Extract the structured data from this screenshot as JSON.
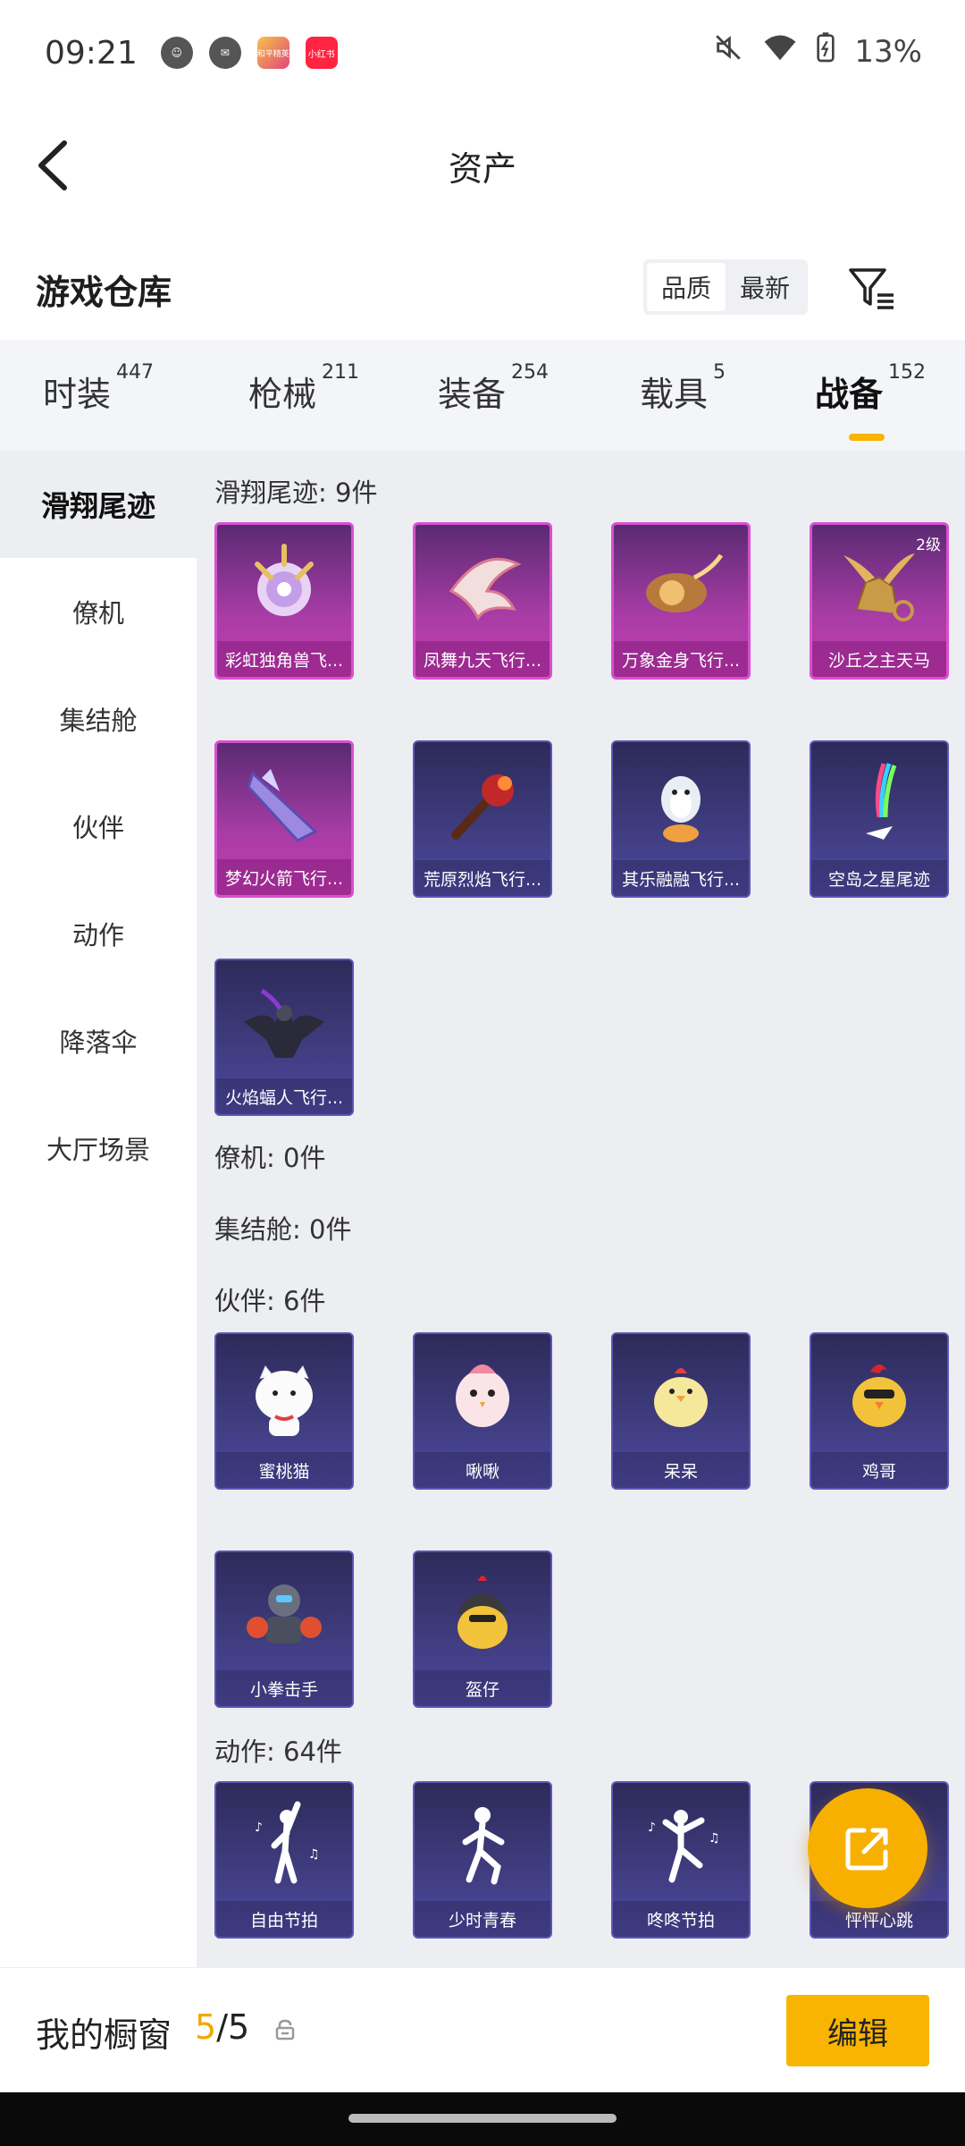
{
  "status_bar": {
    "time": "09:21",
    "battery": "13%",
    "notif_game_label": "和平精英",
    "notif_red_label": "小红书"
  },
  "header": {
    "title": "资产"
  },
  "warehouse": {
    "title": "游戏仓库",
    "sort_options": [
      "品质",
      "最新"
    ],
    "active_sort": "品质"
  },
  "tabs": [
    {
      "label": "时装",
      "count": "447"
    },
    {
      "label": "枪械",
      "count": "211"
    },
    {
      "label": "装备",
      "count": "254"
    },
    {
      "label": "载具",
      "count": "5"
    },
    {
      "label": "战备",
      "count": "152"
    }
  ],
  "active_tab": "战备",
  "sidebar": {
    "items": [
      "滑翔尾迹",
      "僚机",
      "集结舱",
      "伙伴",
      "动作",
      "降落伞",
      "大厅场景"
    ],
    "active": "滑翔尾迹"
  },
  "sections": {
    "glide": {
      "title": "滑翔尾迹: 9件",
      "items": [
        {
          "name": "彩虹独角兽飞...",
          "rarity": "pink",
          "icon": "unicorn-mask-icon"
        },
        {
          "name": "凤舞九天飞行...",
          "rarity": "pink",
          "icon": "phoenix-wing-icon"
        },
        {
          "name": "万象金身飞行...",
          "rarity": "pink",
          "icon": "golden-comet-icon"
        },
        {
          "name": "沙丘之主天马",
          "rarity": "pink",
          "icon": "pegasus-icon",
          "level": "2级"
        },
        {
          "name": "梦幻火箭飞行...",
          "rarity": "pink",
          "icon": "rocket-glider-icon"
        },
        {
          "name": "荒原烈焰飞行...",
          "rarity": "purple",
          "icon": "flame-glider-icon"
        },
        {
          "name": "其乐融融飞行...",
          "rarity": "purple",
          "icon": "penguin-glider-icon"
        },
        {
          "name": "空岛之星尾迹",
          "rarity": "purple",
          "icon": "rainbow-trail-icon"
        },
        {
          "name": "火焰蝠人飞行...",
          "rarity": "purple",
          "icon": "bat-man-icon"
        }
      ]
    },
    "wingman": {
      "title": "僚机: 0件"
    },
    "pod": {
      "title": "集结舱: 0件"
    },
    "partner": {
      "title": "伙伴: 6件",
      "items": [
        {
          "name": "蜜桃猫",
          "icon": "peach-cat-icon"
        },
        {
          "name": "啾啾",
          "icon": "pink-bird-icon"
        },
        {
          "name": "呆呆",
          "icon": "yellow-chick-icon"
        },
        {
          "name": "鸡哥",
          "icon": "rooster-icon"
        },
        {
          "name": "小拳击手",
          "icon": "boxer-robot-icon"
        },
        {
          "name": "盔仔",
          "icon": "helmet-chick-icon"
        }
      ]
    },
    "emote": {
      "title": "动作: 64件",
      "items": [
        {
          "name": "自由节拍",
          "icon": "dance-figure-icon"
        },
        {
          "name": "少时青春",
          "icon": "dance-figure-icon"
        },
        {
          "name": "咚咚节拍",
          "icon": "dance-figure-icon"
        },
        {
          "name": "怦怦心跳",
          "icon": "dance-figure-icon"
        }
      ]
    }
  },
  "bottom_bar": {
    "label": "我的橱窗",
    "current": "5",
    "total": "/5",
    "edit_label": "编辑"
  },
  "colors": {
    "accent": "#f8b400",
    "pink_card": "#c23fb0",
    "purple_card": "#4d48a0"
  }
}
